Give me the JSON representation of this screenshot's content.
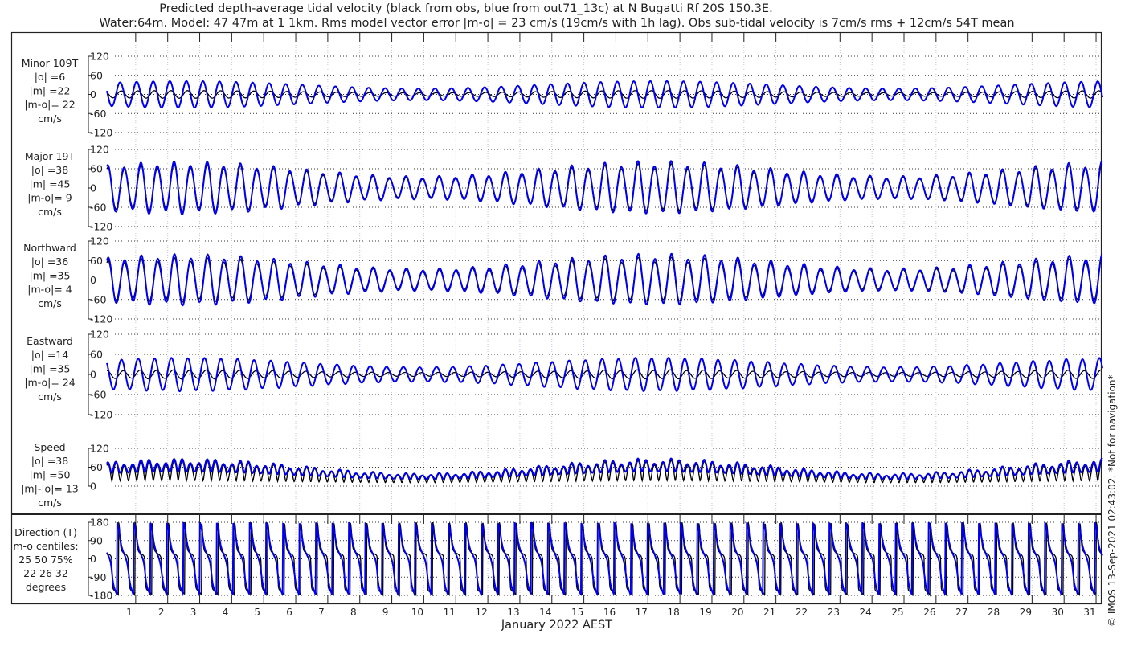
{
  "chart_data": {
    "type": "line",
    "title": "Predicted depth-average tidal velocity (black from obs, blue from out71_13c) at N Bugatti Rf 20S 150.3E.",
    "subtitle": "Water:64m. Model: 47 47m at 1 1km. Rms model vector error |m-o| = 23 cm/s (19cm/s with 1h lag). Obs sub-tidal velocity is 7cm/s rms + 12cm/s 54T mean",
    "xlabel": "January 2022 AEST",
    "x_ticks": [
      "1",
      "2",
      "3",
      "4",
      "5",
      "6",
      "7",
      "8",
      "9",
      "10",
      "11",
      "12",
      "13",
      "14",
      "15",
      "16",
      "17",
      "18",
      "19",
      "20",
      "21",
      "22",
      "23",
      "24",
      "25",
      "26",
      "27",
      "28",
      "29",
      "30",
      "31"
    ],
    "x_range_days": [
      0.1,
      31.2
    ],
    "copyright": "© IMOS 13-Sep-2021 02:43:02. *Not for navigation*",
    "series_colors": {
      "obs": "#000000",
      "model": "#0000ee"
    },
    "tidal_model": {
      "semidiurnal_cycles_per_day": 1.932,
      "spring_neap_period_days": 14.77,
      "spring_peak_day": 2.5
    },
    "panels": [
      {
        "id": "minor",
        "labels": [
          "Minor 109T",
          "|o| =6",
          "|m| =22",
          "|m-o|= 22",
          "cm/s"
        ],
        "ylim": [
          -120,
          120
        ],
        "yticks": [
          "120",
          "60",
          "0",
          "-60",
          "-120"
        ],
        "yvals": [
          120,
          60,
          0,
          -60,
          -120
        ],
        "obs_amp": 12,
        "model_amp": 42
      },
      {
        "id": "major",
        "labels": [
          "Major 19T",
          "|o| =38",
          "|m| =45",
          "|m-o|= 9",
          "cm/s"
        ],
        "ylim": [
          -120,
          120
        ],
        "yticks": [
          "120",
          "60",
          "0",
          "-60",
          "-120"
        ],
        "yvals": [
          120,
          60,
          0,
          -60,
          -120
        ],
        "obs_amp": 68,
        "model_amp": 76
      },
      {
        "id": "north",
        "labels": [
          "Northward",
          "|o| =36",
          "|m| =35",
          "|m-o|= 4",
          "cm/s"
        ],
        "ylim": [
          -120,
          120
        ],
        "yticks": [
          "120",
          "60",
          "0",
          "-60",
          "-120"
        ],
        "yvals": [
          120,
          60,
          0,
          -60,
          -120
        ]
      },
      {
        "id": "east",
        "labels": [
          "Eastward",
          "|o| =14",
          "|m| =35",
          "|m-o|= 24",
          "cm/s"
        ],
        "ylim": [
          -120,
          120
        ],
        "yticks": [
          "120",
          "60",
          "0",
          "-60",
          "-120"
        ],
        "yvals": [
          120,
          60,
          0,
          -60,
          -120
        ]
      },
      {
        "id": "speed",
        "labels": [
          "Speed",
          "|o| =38",
          "|m| =50",
          "|m|-|o|= 13",
          "cm/s"
        ],
        "ylim": [
          0,
          120
        ],
        "yticks": [
          "120",
          "60",
          "0"
        ],
        "yvals": [
          120,
          60,
          0
        ]
      },
      {
        "id": "direction",
        "labels": [
          "Direction (T)",
          "m-o centiles:",
          "25  50  75%",
          "22  26  32",
          "degrees"
        ],
        "ylim": [
          -180,
          180
        ],
        "yticks": [
          "180",
          "90",
          "0",
          "-90",
          "-180"
        ],
        "yvals": [
          180,
          90,
          0,
          -90,
          -180
        ]
      }
    ]
  }
}
